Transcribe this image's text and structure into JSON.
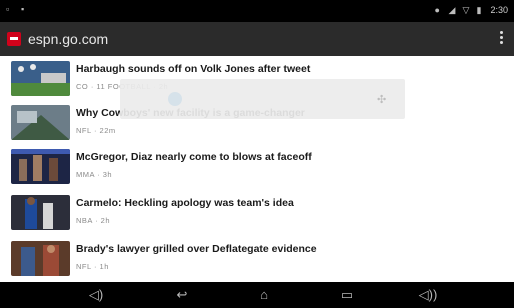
{
  "status_bar": {
    "left_icons": [
      "notification-icon",
      "notification-icon"
    ],
    "right_icons": [
      "location-icon",
      "wifi-icon",
      "signal-icon",
      "battery-icon"
    ],
    "time": "2:30"
  },
  "url_bar": {
    "favicon": "espn-favicon",
    "url": "espn.go.com",
    "menu_icon": "overflow-menu-icon"
  },
  "articles": [
    {
      "headline": "Harbaugh sounds off on Volk Jones after tweet",
      "meta": "CO · 11 FOOTBALL · 2h"
    },
    {
      "headline": "Why Cowboys' new facility is a game-changer",
      "meta": "NFL · 22m"
    },
    {
      "headline": "McGregor, Diaz nearly come to blows at faceoff",
      "meta": "MMA · 3h"
    },
    {
      "headline": "Carmelo: Heckling apology was team's idea",
      "meta": "NBA · 2h"
    },
    {
      "headline": "Brady's lawyer grilled over Deflategate evidence",
      "meta": "NFL · 1h"
    }
  ],
  "nav_bar": {
    "items": [
      "volume-down-icon",
      "back-icon",
      "home-icon",
      "recent-apps-icon",
      "volume-up-icon"
    ]
  }
}
